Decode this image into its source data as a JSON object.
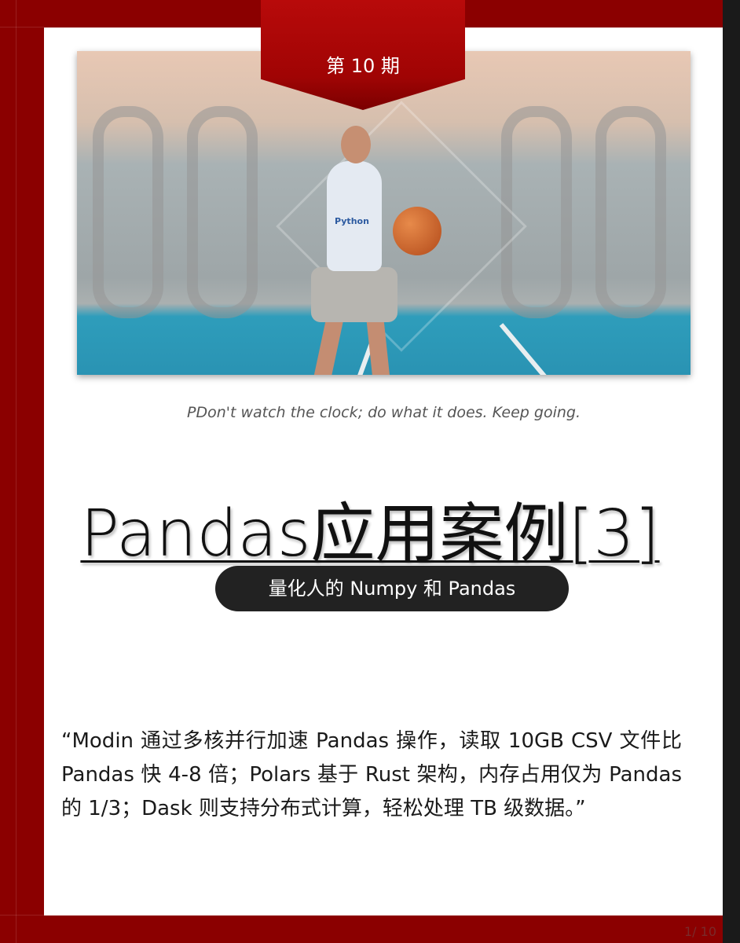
{
  "cover": {
    "issue_label": "第 10 期",
    "quote": "PDon't watch the clock; do what it does. Keep going.",
    "title": "Pandas应用案例[3]",
    "subtitle": "量化人的 Numpy 和 Pandas",
    "body": "“Modin 通过多核并行加速 Pandas 操作，读取 10GB CSV 文件比 Pandas 快 4-8 倍；Polars 基于 Rust 架构，内存占用仅为 Pandas 的 1/3；Dask 则支持分布式计算，轻松处理 TB 级数据。”",
    "page_number": "1/ 10",
    "photo_shirt_text": "Python"
  },
  "colors": {
    "frame_red": "#8b0000",
    "tab_red": "#b80a0a",
    "pill_bg": "#222222",
    "page_bg": "#ffffff"
  }
}
